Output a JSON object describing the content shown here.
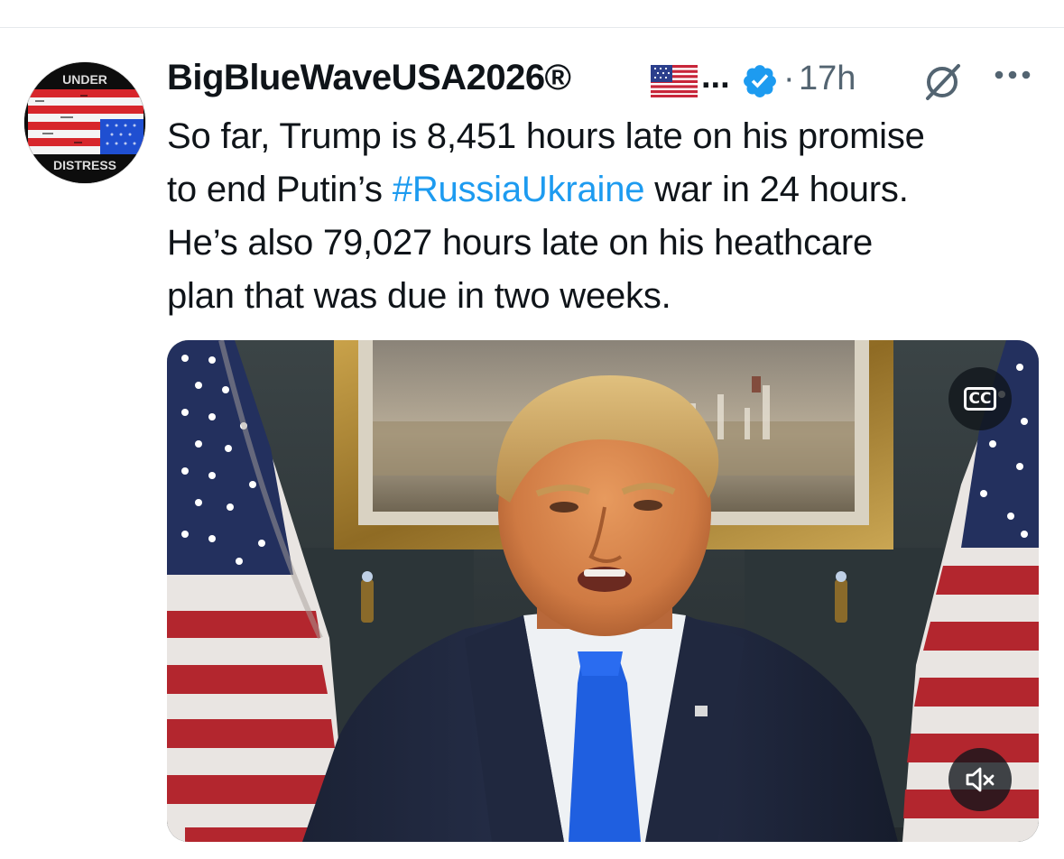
{
  "tweet": {
    "display_name": "BigBlueWaveUSA2026®",
    "name_overflow": "...",
    "dot": "·",
    "time": "17h",
    "text_lines": [
      [
        "So far, Trump is 8,451 hours late on his promise"
      ],
      [
        "to end Putin’s ",
        "#RussiaUkraine",
        " war in 24 hours."
      ],
      [
        "He’s also 79,027 hours late on his heathcare"
      ],
      [
        "plan that was due in two weeks."
      ]
    ],
    "hashtag_color": "#1d9bf0"
  },
  "avatar": {
    "top_text": "UNDER",
    "bottom_text": "DISTRESS"
  },
  "icons": {
    "flag": "us-flag-emoji",
    "verified": "verified-badge-icon",
    "grok": "grok-icon",
    "more": "more-options-icon",
    "captions": "closed-captions-icon",
    "mute": "muted-speaker-icon"
  },
  "video": {
    "captions_label": "CC"
  },
  "colors": {
    "text": "#0f1419",
    "secondary": "#536471",
    "accent": "#1d9bf0"
  }
}
